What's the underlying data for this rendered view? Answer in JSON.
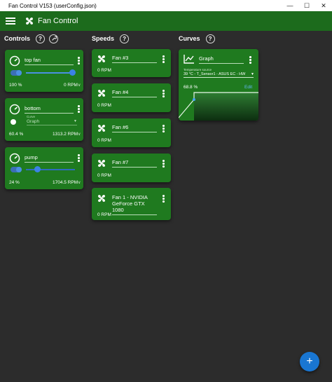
{
  "window": {
    "title": "Fan Control V153 (userConfig.json)"
  },
  "appbar": {
    "title": "Fan Control"
  },
  "sections": {
    "controls": "Controls",
    "speeds": "Speeds",
    "curves": "Curves"
  },
  "controls": [
    {
      "name": "top fan",
      "percent": "100 %",
      "rpm": "0 RPM",
      "slider": 1.0
    },
    {
      "name": "bottom",
      "curve_label": "Curve",
      "curve_value": "Graph",
      "percent": "60.4 %",
      "rpm": "1313.2 RPM"
    },
    {
      "name": "pump",
      "percent": "24 %",
      "rpm": "1704.5 RPM",
      "slider": 0.24
    }
  ],
  "speeds": [
    {
      "name": "Fan #3",
      "rpm": "0 RPM"
    },
    {
      "name": "Fan #4",
      "rpm": "0 RPM"
    },
    {
      "name": "Fan #6",
      "rpm": "0 RPM"
    },
    {
      "name": "Fan #7",
      "rpm": "0 RPM"
    },
    {
      "name_line1": "Fan 1 - NVIDIA",
      "name_line2": "GeForce GTX 1080",
      "rpm": "0 RPM"
    }
  ],
  "curves": [
    {
      "name": "Graph",
      "source_label": "Temperature source",
      "source_value": "39 °C - T_Sensor1 - ASUS EC - HW",
      "percent": "68.8 %",
      "edit": "Edit"
    }
  ],
  "fab": {
    "icon": "+"
  },
  "colors": {
    "card": "#1f7a1f",
    "appbar": "#1c6b1c",
    "background": "#2c2c2c",
    "accent": "#1976d2"
  }
}
